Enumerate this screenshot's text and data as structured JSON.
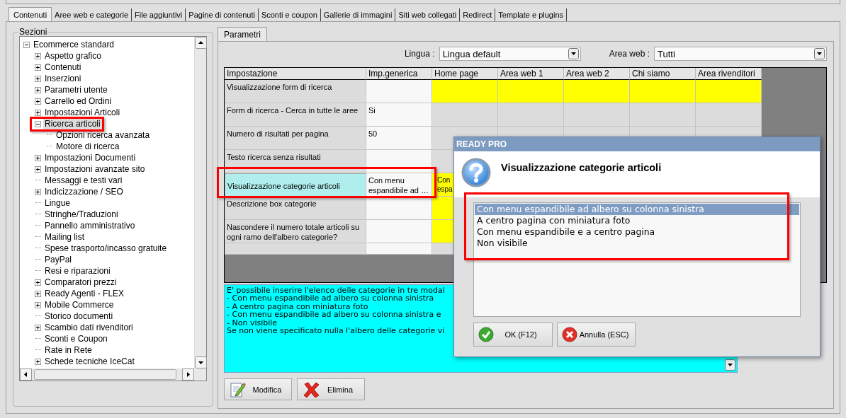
{
  "tabs": [
    {
      "label": "Contenuti",
      "selected": true
    },
    {
      "label": "Aree web e categorie",
      "selected": false
    },
    {
      "label": "File aggiuntivi",
      "selected": false
    },
    {
      "label": "Pagine di contenuti",
      "selected": false
    },
    {
      "label": "Sconti e coupon",
      "selected": false
    },
    {
      "label": "Gallerie di immagini",
      "selected": false
    },
    {
      "label": "Siti web collegati",
      "selected": false
    },
    {
      "label": "Redirect",
      "selected": false
    },
    {
      "label": "Template e plugins",
      "selected": false
    }
  ],
  "sections": {
    "title": "Sezioni",
    "tree": [
      {
        "label": "Ecommerce standard",
        "expandable": true,
        "expanded": true,
        "selected": false,
        "children": [
          {
            "label": "Aspetto grafico",
            "expandable": true,
            "expanded": false,
            "selected": false
          },
          {
            "label": "Contenuti",
            "expandable": true,
            "expanded": false,
            "selected": false
          },
          {
            "label": "Inserzioni",
            "expandable": true,
            "expanded": false,
            "selected": false
          },
          {
            "label": "Parametri utente",
            "expandable": true,
            "expanded": false,
            "selected": false
          },
          {
            "label": "Carrello ed Ordini",
            "expandable": true,
            "expanded": false,
            "selected": false
          },
          {
            "label": "Impostazioni Articoli",
            "expandable": true,
            "expanded": false,
            "selected": false
          },
          {
            "label": "Ricerca articoli",
            "expandable": true,
            "expanded": true,
            "selected": true,
            "children": [
              {
                "label": "Opzioni ricerca avanzata",
                "expandable": false,
                "selected": false
              },
              {
                "label": "Motore di ricerca",
                "expandable": false,
                "selected": false
              }
            ]
          },
          {
            "label": "Impostazioni Documenti",
            "expandable": true,
            "expanded": false,
            "selected": false
          },
          {
            "label": "Impostazioni avanzate sito",
            "expandable": true,
            "expanded": false,
            "selected": false
          },
          {
            "label": "Messaggi e testi vari",
            "expandable": false,
            "selected": false
          },
          {
            "label": "Indicizzazione / SEO",
            "expandable": true,
            "expanded": false,
            "selected": false
          },
          {
            "label": "Lingue",
            "expandable": false,
            "selected": false
          },
          {
            "label": "Stringhe/Traduzioni",
            "expandable": false,
            "selected": false
          },
          {
            "label": "Pannello amministrativo",
            "expandable": false,
            "selected": false
          },
          {
            "label": "Mailing list",
            "expandable": false,
            "selected": false
          },
          {
            "label": "Spese trasporto/incasso gratuite",
            "expandable": false,
            "selected": false
          },
          {
            "label": "PayPal",
            "expandable": false,
            "selected": false
          },
          {
            "label": "Resi e riparazioni",
            "expandable": false,
            "selected": false
          },
          {
            "label": "Comparatori prezzi",
            "expandable": true,
            "expanded": false,
            "selected": false
          },
          {
            "label": "Ready Agenti - FLEX",
            "expandable": true,
            "expanded": false,
            "selected": false
          },
          {
            "label": "Mobile Commerce",
            "expandable": true,
            "expanded": false,
            "selected": false
          },
          {
            "label": "Storico documenti",
            "expandable": false,
            "selected": false
          },
          {
            "label": "Scambio dati rivenditori",
            "expandable": true,
            "expanded": false,
            "selected": false
          },
          {
            "label": "Sconti e Coupon",
            "expandable": false,
            "selected": false
          },
          {
            "label": "Rate in Rete",
            "expandable": false,
            "selected": false
          },
          {
            "label": "Schede tecniche IceCat",
            "expandable": true,
            "expanded": false,
            "selected": false
          }
        ]
      }
    ]
  },
  "subtabs": [
    {
      "label": "Parametri",
      "selected": true
    }
  ],
  "filters": [
    {
      "label": "Lingua :",
      "value": "Lingua default"
    },
    {
      "label": "Area web :",
      "value": "Tutti"
    }
  ],
  "grid": {
    "columns": [
      "Impostazione",
      "Imp.generica",
      "Home page",
      "Area web 1",
      "Area web 2",
      "Chi siamo",
      "Area rivenditori"
    ],
    "rows": [
      {
        "selected": false,
        "cells": [
          {
            "text": "Visualizzazione form di ricerca"
          },
          {
            "text": ""
          },
          {
            "text": "",
            "highlighted": true
          },
          {
            "text": "",
            "highlighted": true
          },
          {
            "text": "",
            "highlighted": true
          },
          {
            "text": "",
            "highlighted": true
          },
          {
            "text": "",
            "highlighted": true
          }
        ]
      },
      {
        "selected": false,
        "cells": [
          {
            "text": "Form di ricerca - Cerca in tutte le aree"
          },
          {
            "text": "Si"
          },
          {
            "text": "",
            "highlighted": false
          },
          {
            "text": "",
            "highlighted": false
          },
          {
            "text": "",
            "highlighted": false
          },
          {
            "text": "",
            "highlighted": false
          },
          {
            "text": "",
            "highlighted": false
          }
        ]
      },
      {
        "selected": false,
        "cells": [
          {
            "text": "Numero di risultati per pagina"
          },
          {
            "text": "50"
          },
          {
            "text": "",
            "highlighted": false
          },
          {
            "text": "",
            "highlighted": false
          },
          {
            "text": "",
            "highlighted": false
          },
          {
            "text": "",
            "highlighted": false
          },
          {
            "text": "",
            "highlighted": false
          }
        ]
      },
      {
        "selected": false,
        "cells": [
          {
            "text": "Testo ricerca senza risultati"
          },
          {
            "text": ""
          },
          {
            "text": "",
            "highlighted": false
          }
        ]
      },
      {
        "selected": true,
        "cells": [
          {
            "text": "Visualizzazione categorie articoli"
          },
          {
            "text": "Con menu espandibile ad …"
          },
          {
            "text": "Con espa",
            "highlighted": true
          }
        ]
      },
      {
        "selected": false,
        "cells": [
          {
            "text": "Descrizione box categorie"
          },
          {
            "text": ""
          },
          {
            "text": "",
            "highlighted": true
          }
        ]
      },
      {
        "selected": false,
        "cells": [
          {
            "text": "Nascondere il numero totale articoli su ogni ramo dell'albero categorie?"
          },
          {
            "text": ""
          },
          {
            "text": "",
            "highlighted": true
          }
        ]
      }
    ]
  },
  "description": {
    "text": "E' possibile inserire l'elenco delle categorie in tre modal\n- Con menu espandibile ad albero su colonna sinistra\n- A centro pagina con miniatura foto\n- Con menu espandibile ad albero su colonna sinistra e\n- Non visibile\nSe non viene specificato nulla l'albero delle categorie vi"
  },
  "buttons": [
    {
      "label": "Modifica",
      "kind": "edit"
    },
    {
      "label": "Elimina",
      "kind": "delete"
    }
  ],
  "dialog": {
    "title": "READY PRO",
    "heading": "Visualizzazione categorie articoli",
    "options": [
      {
        "label": "Con menu espandibile ad albero su colonna sinistra",
        "selected": true
      },
      {
        "label": "A centro pagina con miniatura foto",
        "selected": false
      },
      {
        "label": "Con menu espandibile e a centro pagina",
        "selected": false
      },
      {
        "label": "Non visibile",
        "selected": false
      }
    ],
    "buttons": [
      {
        "label": "OK (F12)",
        "kind": "ok"
      },
      {
        "label": "Annulla (ESC)",
        "kind": "cancel"
      }
    ]
  }
}
